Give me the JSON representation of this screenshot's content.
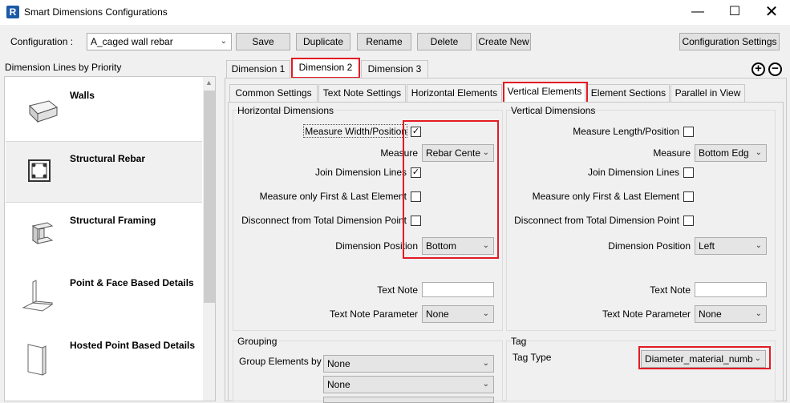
{
  "window": {
    "app_icon_letter": "R",
    "title": "Smart Dimensions Configurations"
  },
  "toolbar": {
    "config_label": "Configuration  :",
    "config_value": "A_caged wall rebar",
    "save": "Save",
    "duplicate": "Duplicate",
    "rename": "Rename",
    "delete": "Delete",
    "create_new": "Create New",
    "config_settings": "Configuration Settings"
  },
  "left_panel": {
    "title": "Dimension Lines by Priority",
    "items": [
      {
        "label": "Walls"
      },
      {
        "label": "Structural Rebar"
      },
      {
        "label": "Structural Framing"
      },
      {
        "label": "Point & Face Based Details"
      },
      {
        "label": "Hosted Point Based Details"
      }
    ]
  },
  "dim_tabs": [
    "Dimension 1",
    "Dimension 2",
    "Dimension 3"
  ],
  "add_glyph": "+",
  "remove_glyph": "−",
  "sub_tabs": [
    "Common Settings",
    "Text Note Settings",
    "Horizontal Elements",
    "Vertical Elements",
    "Element Sections",
    "Parallel in View"
  ],
  "horizontal": {
    "title": "Horizontal Dimensions",
    "measure_width": "Measure Width/Position",
    "measure_width_checked": "✓",
    "measure": "Measure",
    "measure_value": "Rebar Cente",
    "join": "Join Dimension Lines",
    "join_checked": "✓",
    "first_last": "Measure only First & Last Element",
    "disconnect": "Disconnect from Total Dimension Point",
    "position": "Dimension Position",
    "position_value": "Bottom",
    "text_note": "Text Note",
    "text_note_param": "Text Note Parameter",
    "text_note_param_value": "None"
  },
  "vertical": {
    "title": "Vertical Dimensions",
    "measure_length": "Measure Length/Position",
    "measure": "Measure",
    "measure_value": "Bottom Edg",
    "join": "Join Dimension Lines",
    "first_last": "Measure only First & Last Element",
    "disconnect": "Disconnect from Total Dimension Point",
    "position": "Dimension Position",
    "position_value": "Left",
    "text_note": "Text Note",
    "text_note_param": "Text Note Parameter",
    "text_note_param_value": "None"
  },
  "grouping": {
    "title": "Grouping",
    "group_by": "Group Elements by",
    "values": [
      "None",
      "None"
    ]
  },
  "tag": {
    "title": "Tag",
    "tag_type": "Tag Type",
    "tag_type_value": "Diameter_material_numb"
  },
  "colors": {
    "accent_red": "#e31b23",
    "revit_blue": "#1b5aa6"
  }
}
